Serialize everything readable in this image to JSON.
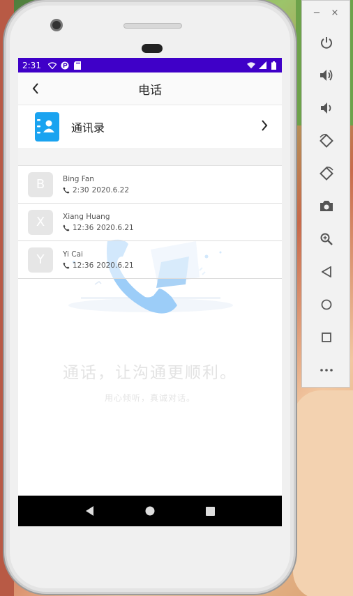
{
  "status_bar": {
    "time": "2:31"
  },
  "toolbar": {
    "title": "电话"
  },
  "contacts_entry": {
    "label": "通讯录"
  },
  "calls": [
    {
      "initial": "B",
      "name": "Bing Fan",
      "time": "2:30",
      "date": "2020.6.22"
    },
    {
      "initial": "X",
      "name": "Xiang Huang",
      "time": "12:36",
      "date": "2020.6.21"
    },
    {
      "initial": "Y",
      "name": "Yi Cai",
      "time": "12:36",
      "date": "2020.6.21"
    }
  ],
  "empty_state": {
    "slogan": "通话，让沟通更顺利。",
    "subslogan": "用心倾听，真诚对话。"
  },
  "emulator_panel": {
    "minimize": "−",
    "close": "×",
    "buttons": [
      "power-icon",
      "volume-up-icon",
      "volume-down-icon",
      "rotate-left-icon",
      "rotate-right-icon",
      "camera-icon",
      "zoom-icon",
      "back-icon",
      "home-icon",
      "overview-icon",
      "more-icon"
    ]
  },
  "colors": {
    "status_bar": "#3f00c8",
    "accent": "#1aa3f0",
    "nav_bar": "#000000"
  }
}
